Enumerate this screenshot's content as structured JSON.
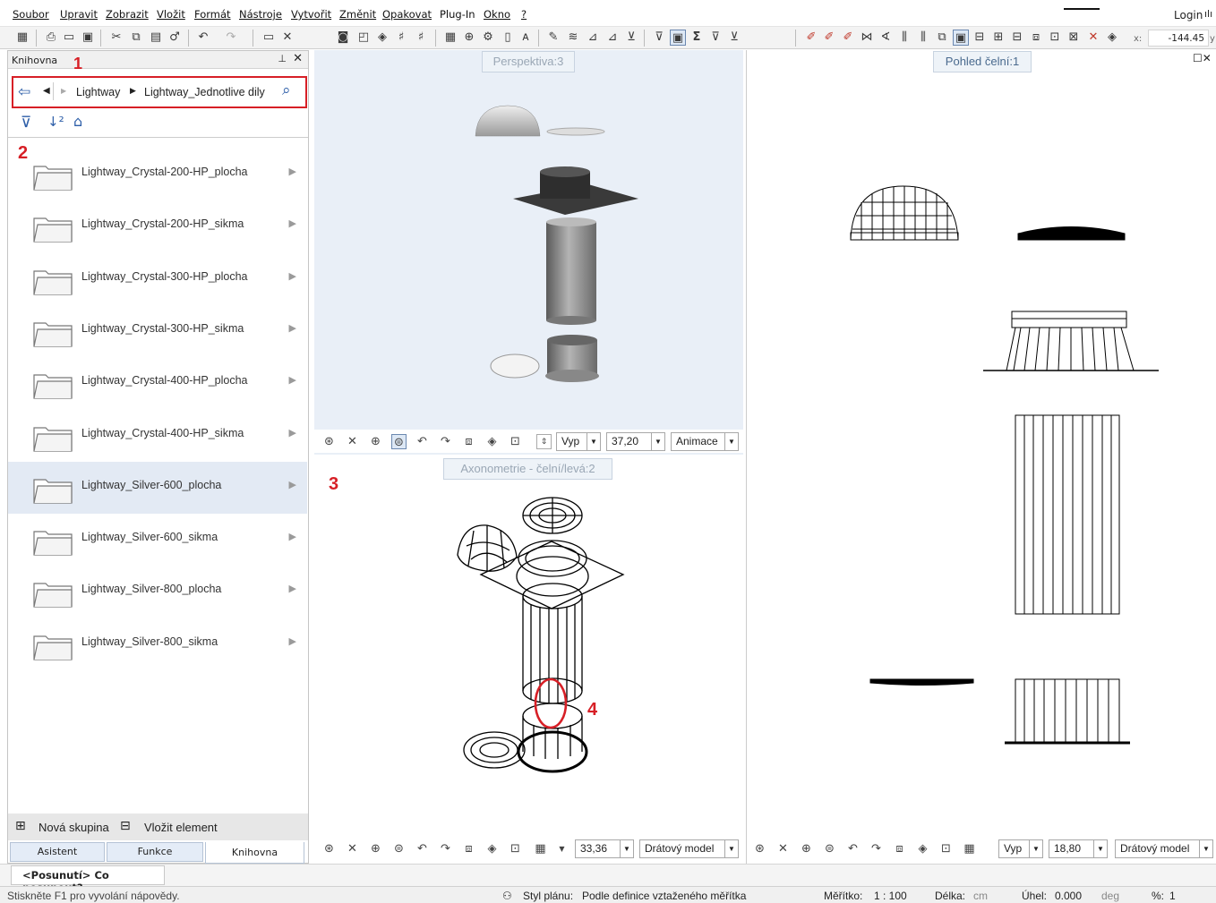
{
  "menubar": {
    "items": [
      "Soubor",
      "Upravit",
      "Zobrazit",
      "Vložit",
      "Formát",
      "Nástroje",
      "Vytvořit",
      "Změnit",
      "Opakovat",
      "Plug-In",
      "Okno",
      "?"
    ],
    "login": "Login",
    "coord_x_label": "x:",
    "coord_x_value": "-144.45",
    "coord_y_label": "y"
  },
  "library": {
    "title": "Knihovna",
    "path": [
      "Lightway",
      "Lightway_Jednotlive dily"
    ],
    "folders": [
      "Lightway_Crystal-200-HP_plocha",
      "Lightway_Crystal-200-HP_sikma",
      "Lightway_Crystal-300-HP_plocha",
      "Lightway_Crystal-300-HP_sikma",
      "Lightway_Crystal-400-HP_plocha",
      "Lightway_Crystal-400-HP_sikma",
      "Lightway_Silver-600_plocha",
      "Lightway_Silver-600_sikma",
      "Lightway_Silver-800_plocha",
      "Lightway_Silver-800_sikma"
    ],
    "selected_folder": "Lightway_Silver-600_plocha",
    "new_group": "Nová skupina",
    "insert_element": "Vložit element",
    "tabs": [
      "Asistent",
      "Funkce",
      "Knihovna"
    ],
    "active_tab": "Knihovna"
  },
  "annotations": [
    "1",
    "2",
    "3",
    "4"
  ],
  "viewports": {
    "perspective": {
      "title": "Perspektiva:3",
      "mode": "Vyp",
      "value": "37,20",
      "combo": "Animace"
    },
    "axonometric": {
      "title": "Axonometrie - čelní/levá:2",
      "value": "33,36",
      "combo": "Drátový model"
    },
    "front": {
      "title": "Pohled čelní:1",
      "mode": "Vyp",
      "value": "18,80",
      "combo": "Drátový model"
    }
  },
  "command_line": "<Posunutí> Co posunout?",
  "status": {
    "help": "Stiskněte F1 pro vyvolání nápovědy.",
    "plan_style_label": "Styl plánu:",
    "plan_style_value": "Podle definice vztaženého měřítka",
    "scale_label": "Měřítko:",
    "scale_value": "1 : 100",
    "length_label": "Délka:",
    "length_unit": "cm",
    "angle_label": "Úhel:",
    "angle_value": "0.000",
    "angle_unit": "deg",
    "percent_label": "%:",
    "percent_value": "1"
  }
}
